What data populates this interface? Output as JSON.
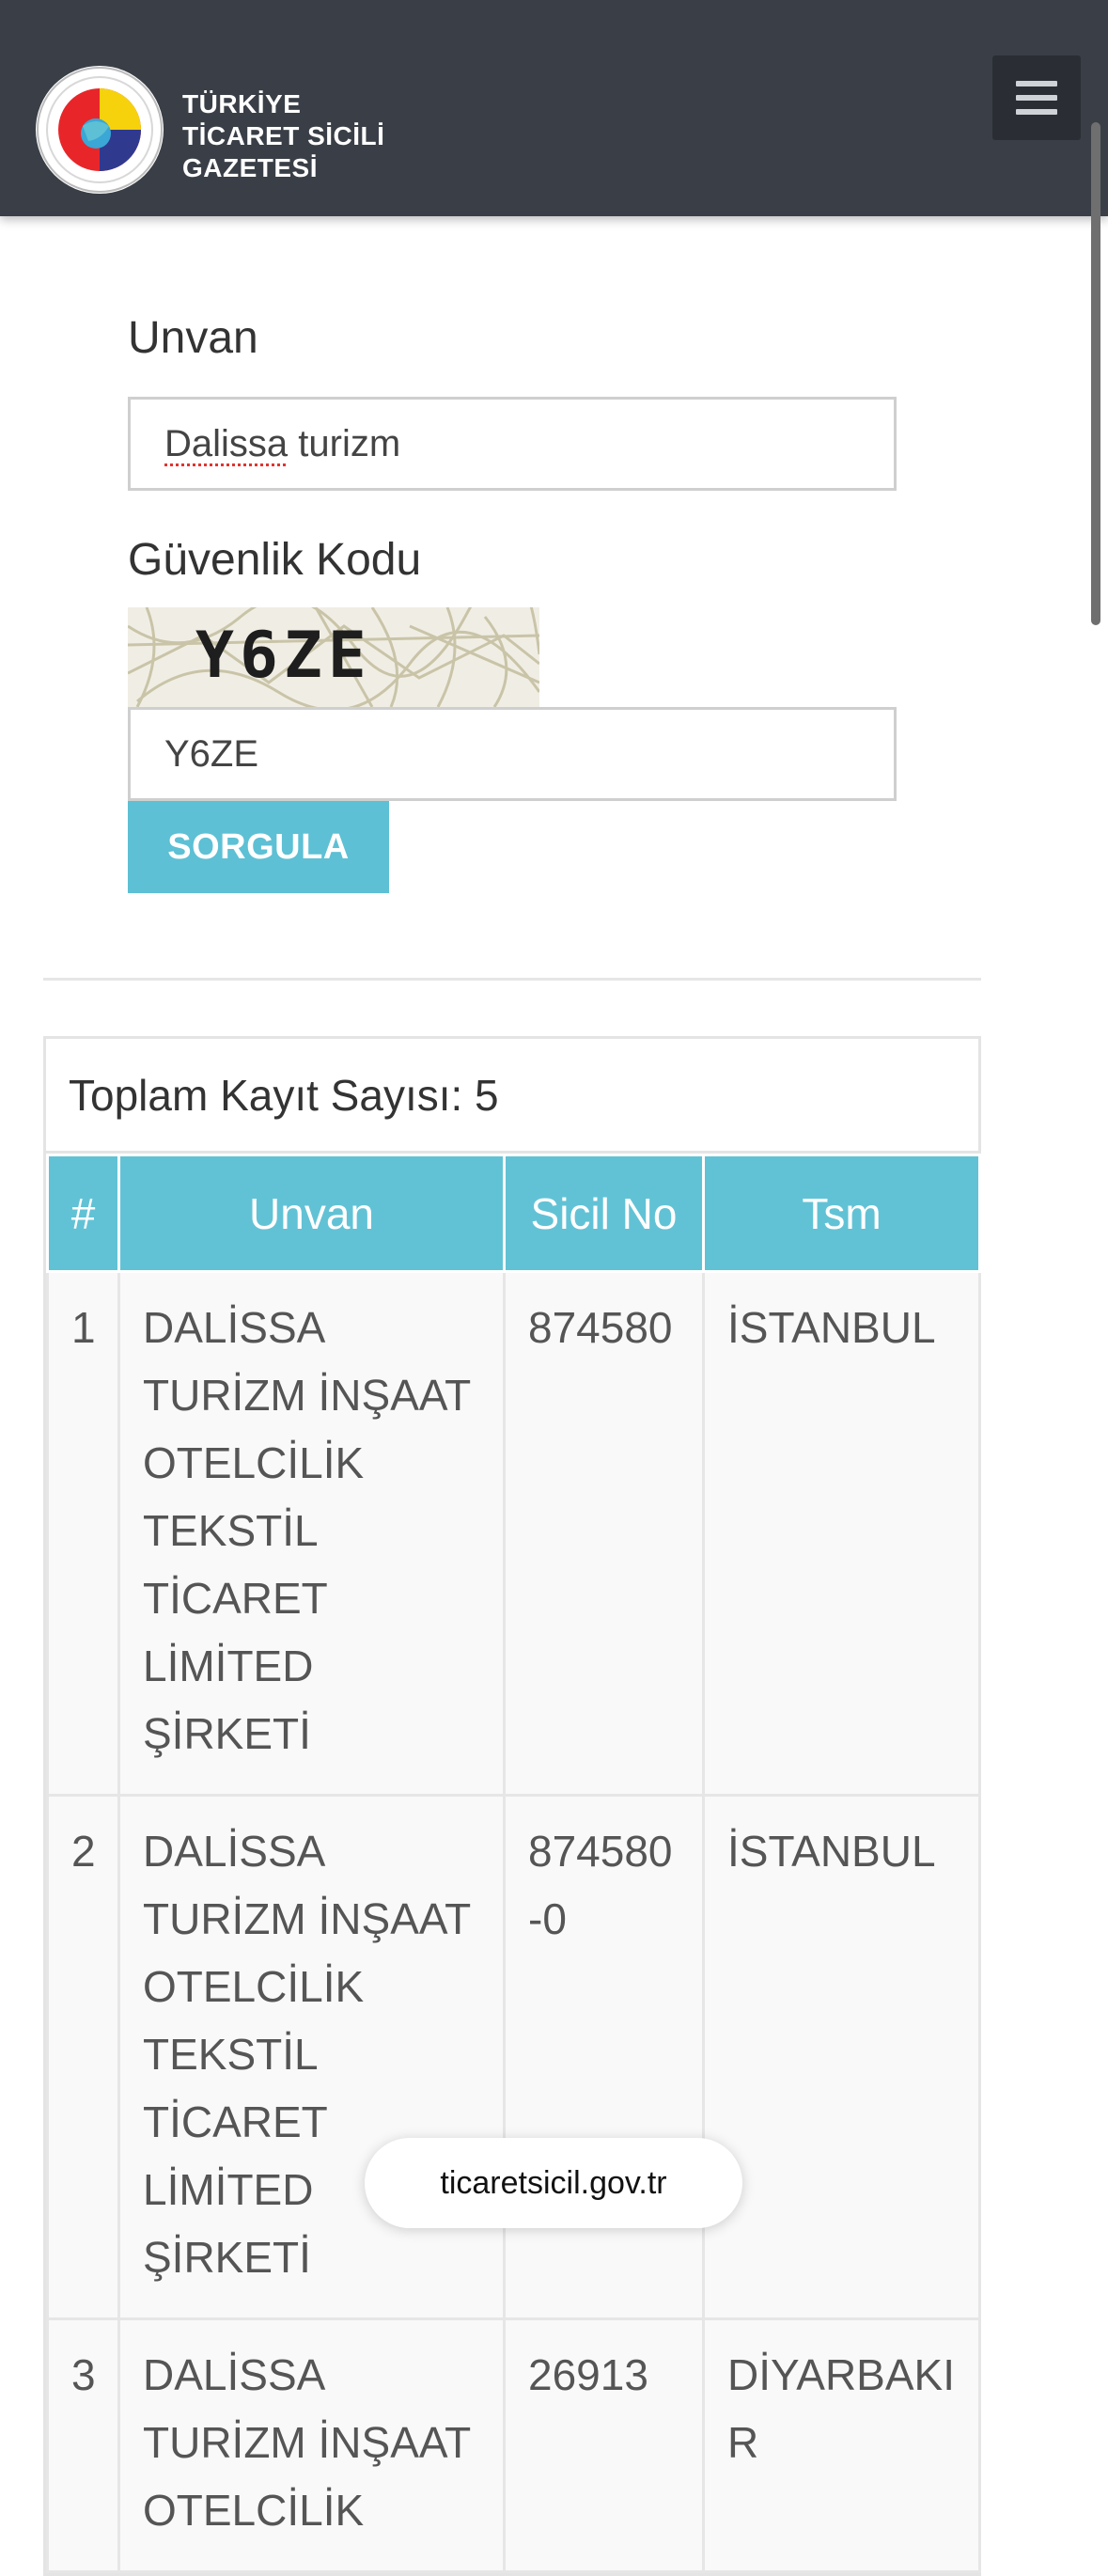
{
  "header": {
    "brand_line1": "TÜRKİYE",
    "brand_line2": "TİCARET SİCİLİ",
    "brand_line3": "GAZETESİ"
  },
  "form": {
    "unvan_label": "Unvan",
    "unvan_value_word1": "Dalissa",
    "unvan_value_word2": " turizm",
    "captcha_label": "Güvenlik Kodu",
    "captcha_image_text": "Y6ZE",
    "captcha_value": "Y6ZE",
    "submit_label": "SORGULA"
  },
  "results": {
    "title": "Toplam Kayıt Sayısı: 5",
    "columns": [
      "#",
      "Unvan",
      "Sicil No",
      "Tsm"
    ],
    "rows": [
      {
        "num": "1",
        "unvan": "DALİSSA TURİZM İNŞAAT OTELCİLİK TEKSTİL TİCARET LİMİTED ŞİRKETİ",
        "sicil": "874580",
        "tsm": "İSTANBUL"
      },
      {
        "num": "2",
        "unvan": "DALİSSA TURİZM İNŞAAT OTELCİLİK TEKSTİL TİCARET LİMİTED ŞİRKETİ",
        "sicil": "874580-0",
        "tsm": "İSTANBUL"
      },
      {
        "num": "3",
        "unvan": "DALİSSA TURİZM İNŞAAT OTELCİLİK",
        "sicil": "26913",
        "tsm": "DİYARBAKIR"
      }
    ]
  },
  "browser": {
    "url": "ticaretsicil.gov.tr"
  },
  "colors": {
    "header_bg": "#3a3f47",
    "accent": "#5dc0d4"
  }
}
